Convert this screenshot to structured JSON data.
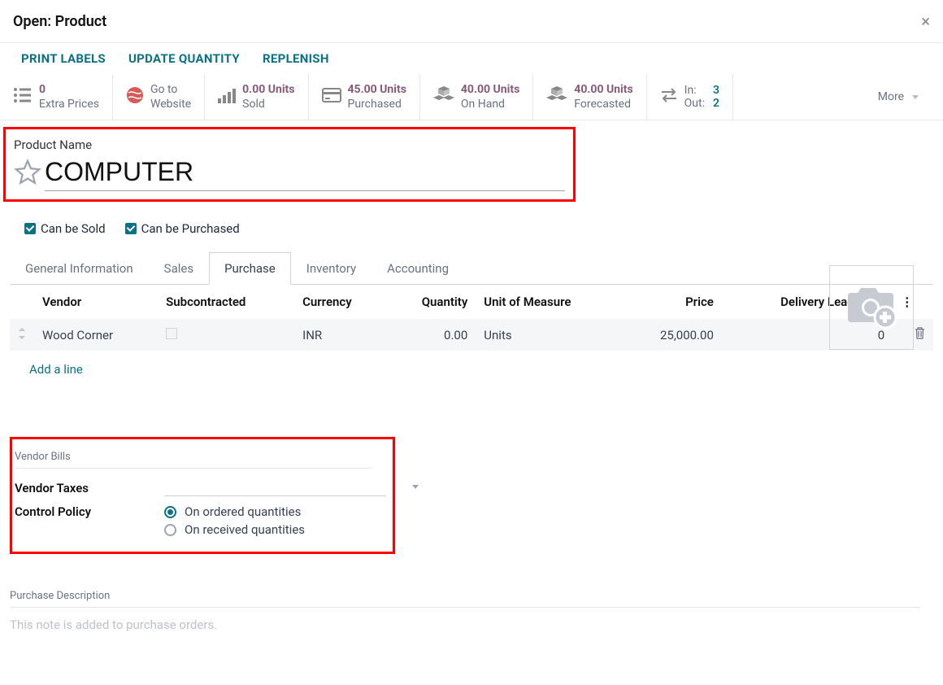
{
  "modal": {
    "title": "Open: Product"
  },
  "actions": {
    "print_labels": "PRINT LABELS",
    "update_qty": "UPDATE QUANTITY",
    "replenish": "REPLENISH"
  },
  "stats": {
    "extra_prices": {
      "value": "0",
      "label": "Extra Prices"
    },
    "website": {
      "top": "Go to",
      "bottom": "Website"
    },
    "sold": {
      "value": "0.00 Units",
      "label": "Sold"
    },
    "purchased": {
      "value": "45.00 Units",
      "label": "Purchased"
    },
    "on_hand": {
      "value": "40.00 Units",
      "label": "On Hand"
    },
    "forecasted": {
      "value": "40.00 Units",
      "label": "Forecasted"
    },
    "in_label": "In:",
    "in_val": "3",
    "out_label": "Out:",
    "out_val": "2",
    "more": "More"
  },
  "product": {
    "name_label": "Product Name",
    "name": "COMPUTER",
    "can_be_sold": "Can be Sold",
    "can_be_purchased": "Can be Purchased"
  },
  "tabs": {
    "general": "General Information",
    "sales": "Sales",
    "purchase": "Purchase",
    "inventory": "Inventory",
    "accounting": "Accounting"
  },
  "table": {
    "headers": {
      "vendor": "Vendor",
      "sub": "Subcontracted",
      "currency": "Currency",
      "qty": "Quantity",
      "uom": "Unit of Measure",
      "price": "Price",
      "dlt": "Delivery Lead Time"
    },
    "rows": [
      {
        "vendor": "Wood Corner",
        "currency": "INR",
        "qty": "0.00",
        "uom": "Units",
        "price": "25,000.00",
        "dlt": "0"
      }
    ],
    "add_line": "Add a line"
  },
  "vendor_bills": {
    "section": "Vendor Bills",
    "taxes_label": "Vendor Taxes",
    "policy_label": "Control Policy",
    "policy_ordered": "On ordered quantities",
    "policy_received": "On received quantities"
  },
  "purchase_desc": {
    "title": "Purchase Description",
    "placeholder": "This note is added to purchase orders."
  }
}
